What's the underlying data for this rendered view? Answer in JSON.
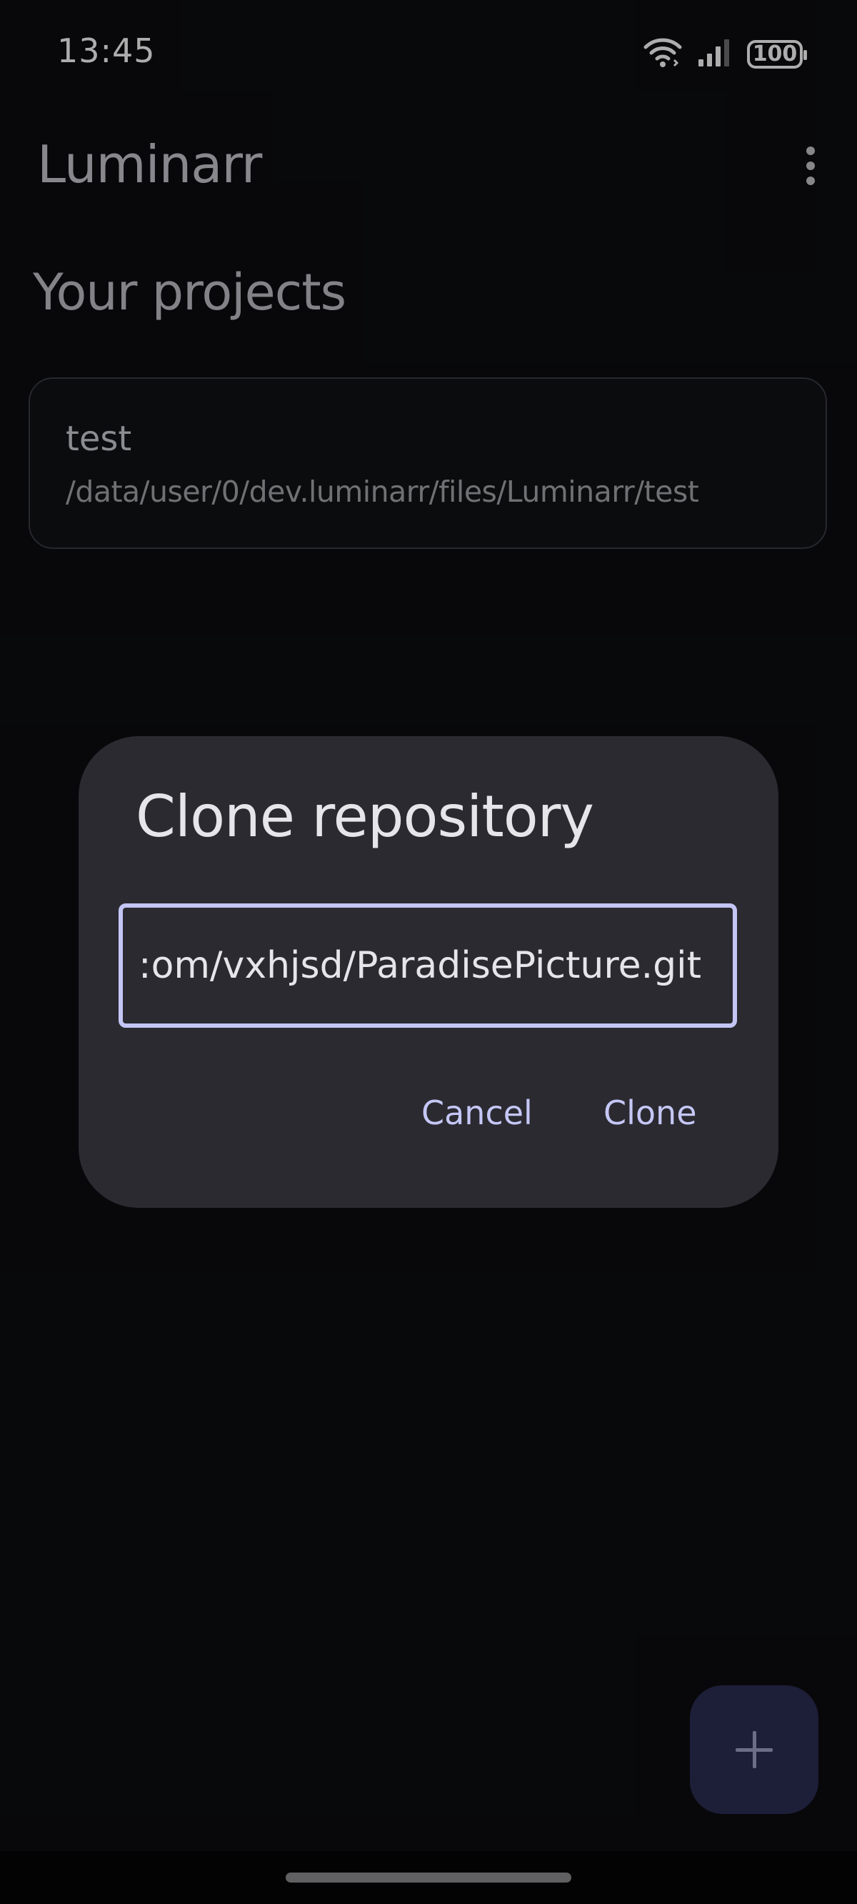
{
  "status_bar": {
    "time": "13:45",
    "battery": "100",
    "icons": [
      "wifi-icon",
      "signal-icon",
      "battery-icon"
    ]
  },
  "app_bar": {
    "title": "Luminarr",
    "menu_icon": "more-vert-icon"
  },
  "main": {
    "section_title": "Your projects",
    "projects": [
      {
        "name": "test",
        "path": "/data/user/0/dev.luminarr/files/Luminarr/test"
      }
    ]
  },
  "dialog": {
    "title": "Clone repository",
    "url_value": ":om/vxhjsd/ParadisePicture.git",
    "cancel_label": "Cancel",
    "confirm_label": "Clone"
  },
  "fab": {
    "icon": "plus-icon"
  },
  "colors": {
    "background": "#0c0d10",
    "dialog": "#2b2a30",
    "accent": "#c5c7f6",
    "fab": "#2c2e54"
  }
}
